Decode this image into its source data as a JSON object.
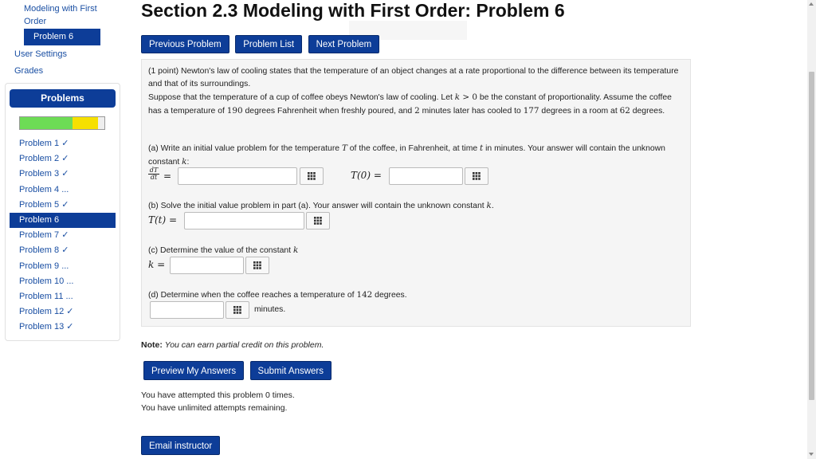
{
  "nav": {
    "crumb": "Modeling with First Order",
    "current": "Problem 6",
    "user_settings": "User Settings",
    "grades": "Grades",
    "problems_header": "Problems",
    "progress": {
      "correct_fraction": 0.62,
      "partial_fraction": 0.3,
      "colors": {
        "correct": "#6ddc55",
        "partial": "#f6e000"
      }
    },
    "problems": [
      {
        "label": "Problem 1 ✓"
      },
      {
        "label": "Problem 2 ✓"
      },
      {
        "label": "Problem 3 ✓"
      },
      {
        "label": "Problem 4 ..."
      },
      {
        "label": "Problem 5 ✓"
      },
      {
        "label": "Problem 6"
      },
      {
        "label": "Problem 7 ✓"
      },
      {
        "label": "Problem 8 ✓"
      },
      {
        "label": "Problem 9 ..."
      },
      {
        "label": "Problem 10 ..."
      },
      {
        "label": "Problem 11 ..."
      },
      {
        "label": "Problem 12 ✓"
      },
      {
        "label": "Problem 13 ✓"
      }
    ]
  },
  "header": {
    "title": "Section 2.3 Modeling with First Order: Problem 6",
    "buttons": {
      "previous": "Previous Problem",
      "list": "Problem List",
      "next": "Next Problem"
    }
  },
  "problem": {
    "intro_1": "(1 point) Newton's law of cooling states that the temperature of an object changes at a rate proportional to the difference between its temperature and that of its surroundings.",
    "intro_2a": "Suppose that the temperature of a cup of coffee obeys Newton's law of cooling. Let ",
    "k": "k",
    "gt_zero": " > 0",
    "intro_2b": " be the constant of proportionality. Assume the coffee has a temperature of ",
    "temp_start": "190",
    "intro_2c": " degrees Fahrenheit when freshly poured, and ",
    "minutes": "2",
    "intro_2d": " minutes later has cooled to ",
    "temp_later": "177",
    "intro_2e": " degrees in a room at ",
    "room_temp": "62",
    "intro_2f": " degrees.",
    "a_1": "(a) Write an initial value problem for the temperature ",
    "T": "T",
    "a_2": " of the coffee, in Fahrenheit, at time ",
    "t": "t",
    "a_3": " in minutes. Your answer will contain the unknown constant ",
    "a_4": ":",
    "dT": "dT",
    "dt": "dt",
    "eq": "=",
    "T0": "T(0) =",
    "b_1": "(b) Solve the initial value problem in part (a). Your answer will contain the unknown constant ",
    "b_2": ".",
    "Tt": "T(t) =",
    "c_1": "(c) Determine the value of the constant ",
    "keq": "k =",
    "d_1": "(d) Determine when the coffee reaches a temperature of ",
    "d_temp": "142",
    "d_2": " degrees.",
    "minutes_unit": "minutes.",
    "answers": {
      "a_rate": "",
      "a_initial": "",
      "b": "",
      "c": "",
      "d": ""
    }
  },
  "note": {
    "label": "Note:",
    "text": "You can earn partial credit on this problem."
  },
  "actions": {
    "preview": "Preview My Answers",
    "submit": "Submit Answers",
    "email": "Email instructor"
  },
  "attempts": {
    "line1": "You have attempted this problem 0 times.",
    "line2": "You have unlimited attempts remaining."
  }
}
